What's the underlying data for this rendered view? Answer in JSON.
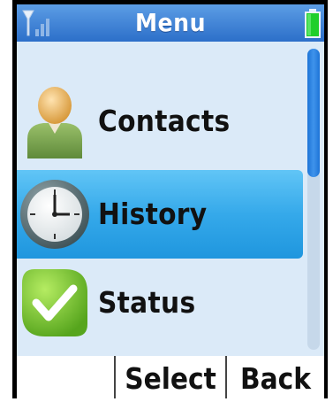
{
  "header": {
    "title": "Menu",
    "signal_icon": "signal-icon",
    "battery_icon": "battery-icon",
    "battery_color": "#1fcf2b"
  },
  "menu": {
    "items": [
      {
        "label": "Contacts",
        "icon": "contacts-icon",
        "selected": false
      },
      {
        "label": "History",
        "icon": "clock-icon",
        "selected": true
      },
      {
        "label": "Status",
        "icon": "checkmark-icon",
        "selected": false
      }
    ],
    "highlight_color": "#35a9ea"
  },
  "softkeys": {
    "left_label": "",
    "select_label": "Select",
    "back_label": "Back"
  }
}
